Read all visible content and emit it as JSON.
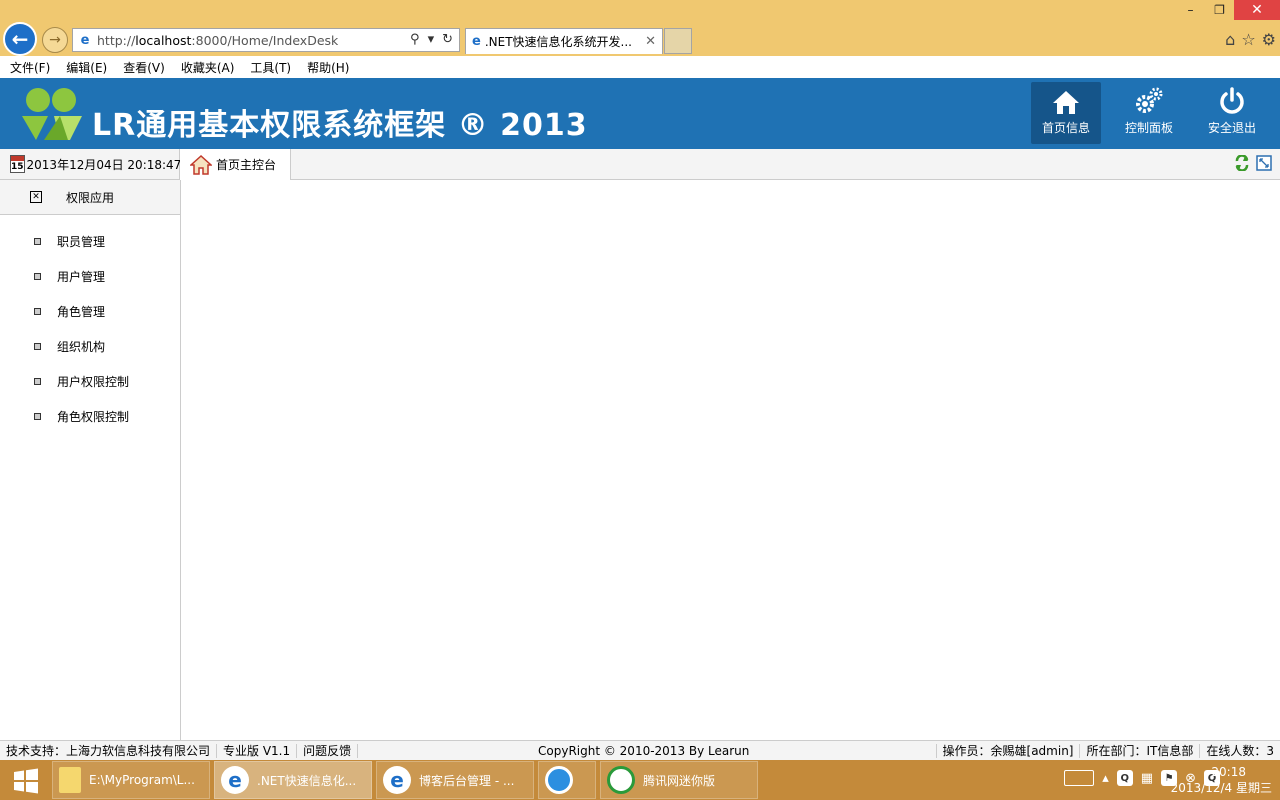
{
  "browser": {
    "url_prefix": "http://",
    "url_host": "localhost",
    "url_rest": ":8000/Home/IndexDesk",
    "tab_title": ".NET快速信息化系统开发...",
    "window_controls": {
      "minimize": "–",
      "restore": "❐",
      "close": "✕"
    },
    "menu": [
      "文件(F)",
      "编辑(E)",
      "查看(V)",
      "收藏夹(A)",
      "工具(T)",
      "帮助(H)"
    ]
  },
  "header": {
    "title": "LR通用基本权限系统框架 ® 2013",
    "buttons": [
      {
        "label": "首页信息",
        "icon": "home-icon",
        "active": true
      },
      {
        "label": "控制面板",
        "icon": "gears-icon",
        "active": false
      },
      {
        "label": "安全退出",
        "icon": "power-icon",
        "active": false
      }
    ]
  },
  "datebar": {
    "calendar_day": "15",
    "datetime": "2013年12月04日 20:18:47"
  },
  "tabbar": {
    "home_tab": "首页主控台"
  },
  "sidebar": {
    "section": "权限应用",
    "items": [
      "职员管理",
      "用户管理",
      "角色管理",
      "组织机构",
      "用户权限控制",
      "角色权限控制"
    ]
  },
  "footer": {
    "support": "技术支持：上海力软信息科技有限公司",
    "edition": "专业版 V1.1",
    "feedback": "问题反馈",
    "copyright": "CopyRight © 2010-2013 By Learun",
    "operator": "操作员：余赐雄[admin]",
    "department": "所在部门：IT信息部",
    "online": "在线人数：3"
  },
  "taskbar": {
    "items": [
      {
        "label": "E:\\MyProgram\\L...",
        "icon": "folder-icon",
        "active": false
      },
      {
        "label": ".NET快速信息化...",
        "icon": "ie-icon",
        "active": true
      },
      {
        "label": "博客后台管理 - ...",
        "icon": "ie-icon",
        "active": false
      },
      {
        "label": "",
        "icon": "qq-browser-icon",
        "active": false
      },
      {
        "label": "腾讯网迷你版",
        "icon": "tencent-news-icon",
        "active": false
      }
    ],
    "clock_time": "20:18",
    "clock_date": "2013/12/4 星期三"
  },
  "colors": {
    "header_bg": "#1f72b4",
    "browser_chrome": "#f0c870",
    "taskbar": "#c48a3a"
  }
}
